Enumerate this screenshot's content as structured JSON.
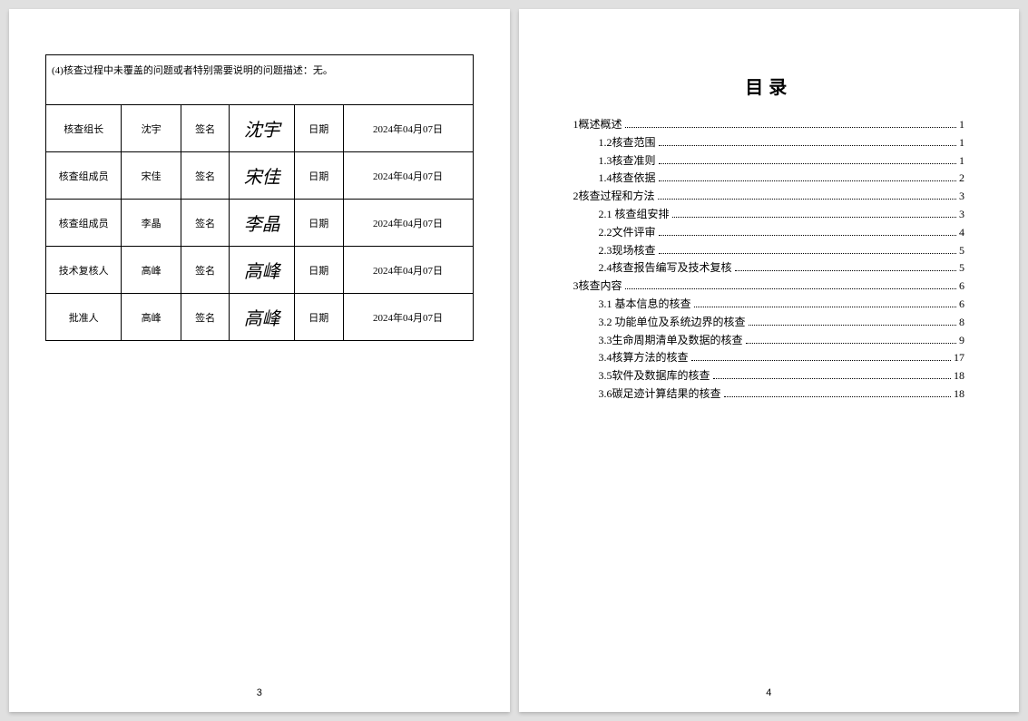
{
  "page1": {
    "note": "(4)核查过程中未覆盖的问题或者特别需要说明的问题描述：无。",
    "rows": [
      {
        "role": "核查组长",
        "name": "沈宇",
        "siglabel": "签名",
        "sig": "沈宇",
        "datelabel": "日期",
        "date": "2024年04月07日"
      },
      {
        "role": "核查组成员",
        "name": "宋佳",
        "siglabel": "签名",
        "sig": "宋佳",
        "datelabel": "日期",
        "date": "2024年04月07日"
      },
      {
        "role": "核查组成员",
        "name": "李晶",
        "siglabel": "签名",
        "sig": "李晶",
        "datelabel": "日期",
        "date": "2024年04月07日"
      },
      {
        "role": "技术复核人",
        "name": "高峰",
        "siglabel": "签名",
        "sig": "高峰",
        "datelabel": "日期",
        "date": "2024年04月07日"
      },
      {
        "role": "批准人",
        "name": "高峰",
        "siglabel": "签名",
        "sig": "高峰",
        "datelabel": "日期",
        "date": "2024年04月07日"
      }
    ],
    "pagenum": "3"
  },
  "page2": {
    "title": "目录",
    "entries": [
      {
        "level": 1,
        "label": "1概述概述",
        "page": "1"
      },
      {
        "level": 2,
        "label": "1.2核查范围",
        "page": "1"
      },
      {
        "level": 2,
        "label": "1.3核查准则",
        "page": "1"
      },
      {
        "level": 2,
        "label": "1.4核查依据",
        "page": "2"
      },
      {
        "level": 1,
        "label": "2核查过程和方法",
        "page": "3"
      },
      {
        "level": 2,
        "label": "2.1 核查组安排",
        "page": "3"
      },
      {
        "level": 2,
        "label": "2.2文件评审",
        "page": "4"
      },
      {
        "level": 2,
        "label": "2.3现场核查",
        "page": "5"
      },
      {
        "level": 2,
        "label": "2.4核查报告编写及技术复核",
        "page": "5"
      },
      {
        "level": 1,
        "label": "3核查内容",
        "page": "6"
      },
      {
        "level": 2,
        "label": "3.1 基本信息的核查",
        "page": "6"
      },
      {
        "level": 2,
        "label": "3.2 功能单位及系统边界的核查",
        "page": "8"
      },
      {
        "level": 2,
        "label": "3.3生命周期清单及数据的核查",
        "page": "9"
      },
      {
        "level": 2,
        "label": "3.4核算方法的核查",
        "page": "17"
      },
      {
        "level": 2,
        "label": "3.5软件及数据库的核查",
        "page": "18"
      },
      {
        "level": 2,
        "label": "3.6碳足迹计算结果的核查",
        "page": "18"
      }
    ],
    "pagenum": "4"
  }
}
